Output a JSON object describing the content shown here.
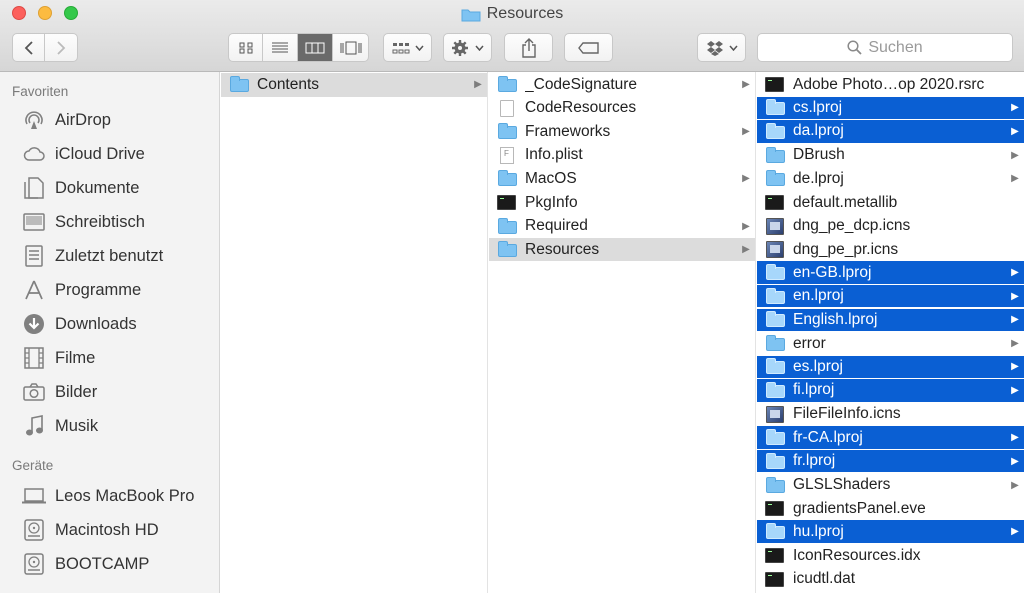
{
  "window": {
    "title": "Resources"
  },
  "toolbar": {
    "search_placeholder": "Suchen"
  },
  "sidebar": {
    "sections": [
      {
        "label": "Favoriten",
        "items": [
          {
            "label": "AirDrop",
            "icon": "airdrop-icon"
          },
          {
            "label": "iCloud Drive",
            "icon": "cloud-icon"
          },
          {
            "label": "Dokumente",
            "icon": "documents-icon"
          },
          {
            "label": "Schreibtisch",
            "icon": "desktop-icon"
          },
          {
            "label": "Zuletzt benutzt",
            "icon": "recents-icon"
          },
          {
            "label": "Programme",
            "icon": "applications-icon"
          },
          {
            "label": "Downloads",
            "icon": "downloads-icon"
          },
          {
            "label": "Filme",
            "icon": "movies-icon"
          },
          {
            "label": "Bilder",
            "icon": "camera-icon"
          },
          {
            "label": "Musik",
            "icon": "music-icon"
          }
        ]
      },
      {
        "label": "Geräte",
        "items": [
          {
            "label": "Leos MacBook Pro",
            "icon": "laptop-icon"
          },
          {
            "label": "Macintosh HD",
            "icon": "disk-icon"
          },
          {
            "label": "BOOTCAMP",
            "icon": "disk-icon"
          }
        ]
      }
    ]
  },
  "columns": [
    {
      "items": [
        {
          "label": "Contents",
          "icon": "folder",
          "arrow": true,
          "sel": "grey"
        }
      ]
    },
    {
      "items": [
        {
          "label": "_CodeSignature",
          "icon": "folder",
          "arrow": true,
          "sel": ""
        },
        {
          "label": "CodeResources",
          "icon": "doc",
          "arrow": false,
          "sel": ""
        },
        {
          "label": "Frameworks",
          "icon": "folder",
          "arrow": true,
          "sel": ""
        },
        {
          "label": "Info.plist",
          "icon": "plist",
          "arrow": false,
          "sel": ""
        },
        {
          "label": "MacOS",
          "icon": "folder",
          "arrow": true,
          "sel": ""
        },
        {
          "label": "PkgInfo",
          "icon": "exec",
          "arrow": false,
          "sel": ""
        },
        {
          "label": "Required",
          "icon": "folder",
          "arrow": true,
          "sel": ""
        },
        {
          "label": "Resources",
          "icon": "folder",
          "arrow": true,
          "sel": "grey"
        }
      ]
    },
    {
      "items": [
        {
          "label": "Adobe Photo…op 2020.rsrc",
          "icon": "exec",
          "arrow": false,
          "sel": ""
        },
        {
          "label": "cs.lproj",
          "icon": "folder",
          "arrow": true,
          "sel": "blue"
        },
        {
          "label": "da.lproj",
          "icon": "folder",
          "arrow": true,
          "sel": "blue"
        },
        {
          "label": "DBrush",
          "icon": "folder",
          "arrow": true,
          "sel": ""
        },
        {
          "label": "de.lproj",
          "icon": "folder",
          "arrow": true,
          "sel": ""
        },
        {
          "label": "default.metallib",
          "icon": "exec",
          "arrow": false,
          "sel": ""
        },
        {
          "label": "dng_pe_dcp.icns",
          "icon": "img",
          "arrow": false,
          "sel": ""
        },
        {
          "label": "dng_pe_pr.icns",
          "icon": "img",
          "arrow": false,
          "sel": ""
        },
        {
          "label": "en-GB.lproj",
          "icon": "folder",
          "arrow": true,
          "sel": "blue"
        },
        {
          "label": "en.lproj",
          "icon": "folder",
          "arrow": true,
          "sel": "blue"
        },
        {
          "label": "English.lproj",
          "icon": "folder",
          "arrow": true,
          "sel": "blue"
        },
        {
          "label": "error",
          "icon": "folder",
          "arrow": true,
          "sel": ""
        },
        {
          "label": "es.lproj",
          "icon": "folder",
          "arrow": true,
          "sel": "blue"
        },
        {
          "label": "fi.lproj",
          "icon": "folder",
          "arrow": true,
          "sel": "blue"
        },
        {
          "label": "FileFileInfo.icns",
          "icon": "img",
          "arrow": false,
          "sel": ""
        },
        {
          "label": "fr-CA.lproj",
          "icon": "folder",
          "arrow": true,
          "sel": "blue"
        },
        {
          "label": "fr.lproj",
          "icon": "folder",
          "arrow": true,
          "sel": "blue"
        },
        {
          "label": "GLSLShaders",
          "icon": "folder",
          "arrow": true,
          "sel": ""
        },
        {
          "label": "gradientsPanel.eve",
          "icon": "exec",
          "arrow": false,
          "sel": ""
        },
        {
          "label": "hu.lproj",
          "icon": "folder",
          "arrow": true,
          "sel": "blue"
        },
        {
          "label": "IconResources.idx",
          "icon": "exec",
          "arrow": false,
          "sel": ""
        },
        {
          "label": "icudtl.dat",
          "icon": "exec",
          "arrow": false,
          "sel": ""
        }
      ]
    }
  ],
  "colors": {
    "selection_blue": "#0a5fd3",
    "selection_grey": "#dcdcdc",
    "folder": "#7ec3f2"
  }
}
